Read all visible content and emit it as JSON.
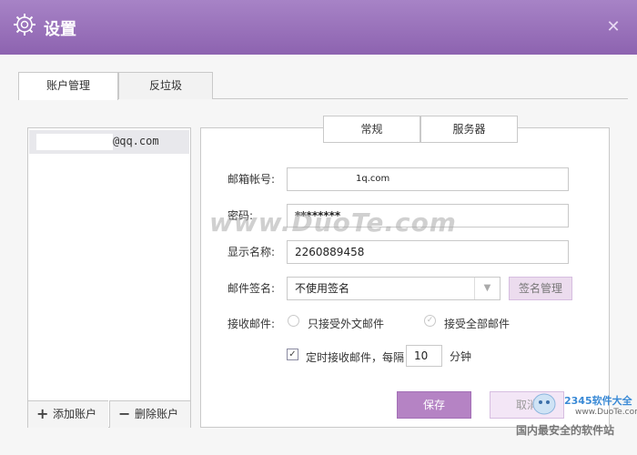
{
  "window": {
    "title": "设置",
    "close_icon": "close-icon"
  },
  "tabs": [
    {
      "label": "账户管理",
      "active": true
    },
    {
      "label": "反垃圾",
      "active": false
    }
  ],
  "accounts": {
    "items": [
      {
        "label": "@qq.com"
      }
    ],
    "add_label": "添加账户",
    "delete_label": "删除账户"
  },
  "subtabs": [
    {
      "label": "常规",
      "active": true
    },
    {
      "label": "服务器",
      "active": false
    }
  ],
  "form": {
    "email_label": "邮箱帐号:",
    "email_value": "1q.com",
    "password_label": "密码:",
    "password_value": "********",
    "display_name_label": "显示名称:",
    "display_name_value": "2260889458",
    "signature_label": "邮件签名:",
    "signature_value": "不使用签名",
    "signature_manage": "签名管理",
    "receive_label": "接收邮件:",
    "receive_options": [
      {
        "label": "只接受外文邮件",
        "checked": false
      },
      {
        "label": "接受全部邮件",
        "checked": true
      }
    ],
    "timer_checked": true,
    "timer_label": "定时接收邮件，每隔",
    "timer_value": "10",
    "timer_unit": "分钟",
    "save_label": "保存",
    "cancel_label": "取消"
  },
  "watermark": {
    "text": "www.DuoTe.com",
    "brand": "2345软件大全",
    "url": "www.DuoTe.com",
    "slogan": "国内最安全的软件站"
  },
  "colors": {
    "titlebar": "#9a72bd",
    "accent": "#b583c4",
    "accent_light": "#ecdcee"
  }
}
